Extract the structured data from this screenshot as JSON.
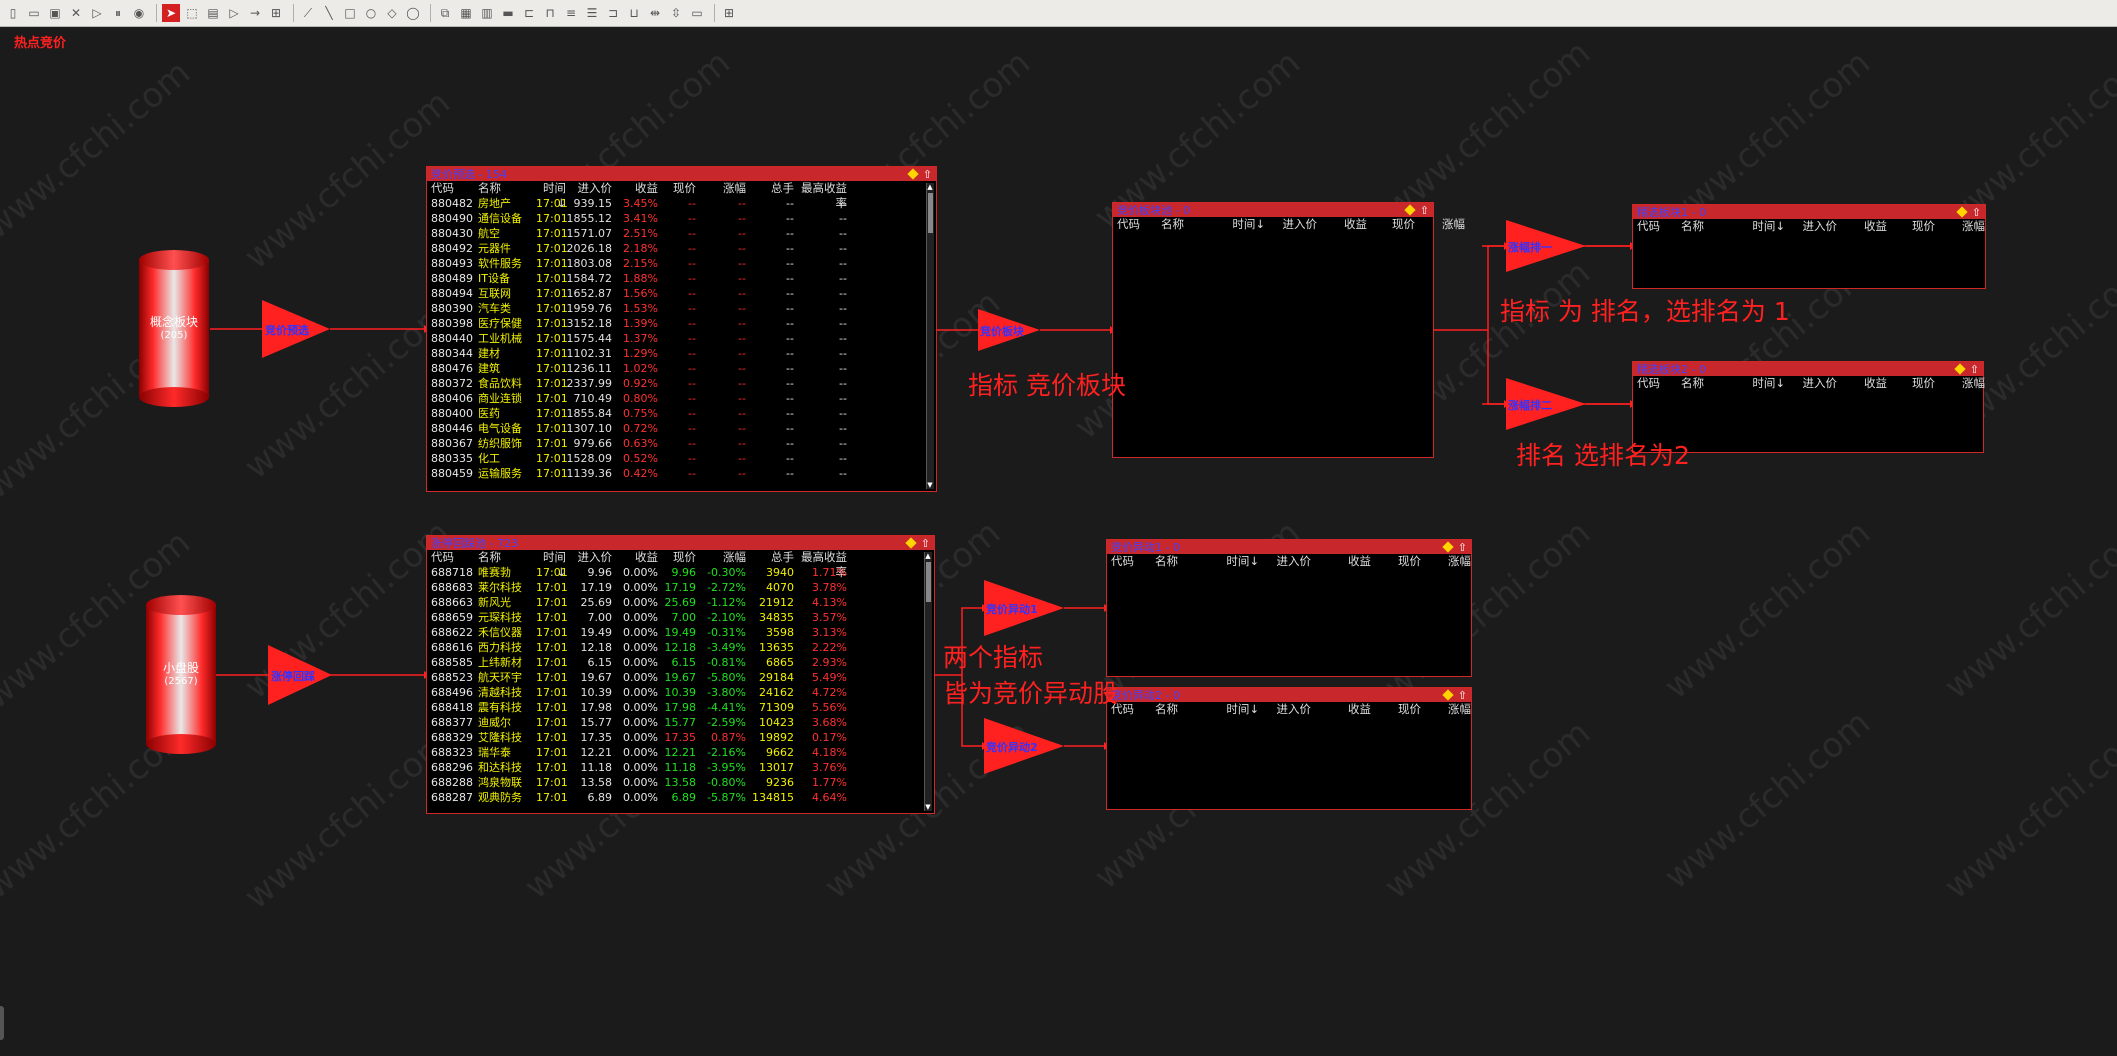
{
  "app": {
    "page_title": "热点竞价"
  },
  "watermark": "www.cfchi.com",
  "toolbar_icons": [
    "new-file-icon",
    "open-folder-icon",
    "save-icon",
    "close-icon",
    "play-icon",
    "pause-icon",
    "stop-icon",
    "|",
    "select-arrow-icon",
    "rect-select-icon",
    "table-icon",
    "triangle-icon",
    "arrow-icon",
    "group-icon",
    "|",
    "link-icon",
    "line-icon",
    "rectangle-icon",
    "circle-icon",
    "diamond-icon",
    "ellipse-icon",
    "|",
    "copy-icon",
    "paste-icon",
    "cut-icon",
    "erase-icon",
    "align-left-icon",
    "align-top-icon",
    "align-center-icon",
    "align-middle-icon",
    "align-right-icon",
    "align-bottom-icon",
    "distribute-h-icon",
    "distribute-v-icon",
    "same-size-icon",
    "|",
    "grid-icon"
  ],
  "sources": [
    {
      "label": "概念板块",
      "count": "(205)"
    },
    {
      "label": "小盘股",
      "count": "(2567)"
    }
  ],
  "triangles": {
    "t1": "竞价预选",
    "t2": "涨停回踩",
    "t3": "竞价板块",
    "t4": "涨幅排一",
    "t5": "涨幅排二",
    "t6": "竞价异动1",
    "t7": "竞价异动2"
  },
  "columns_full": [
    "代码",
    "名称",
    "时间↓",
    "进入价",
    "收益",
    "现价",
    "涨幅",
    "总手",
    "最高收益率"
  ],
  "columns_short": [
    "代码",
    "名称",
    "时间↓",
    "进入价",
    "收益",
    "现价",
    "涨幅"
  ],
  "panels": {
    "p1": {
      "title": "竞价预选 - 154",
      "rows": [
        [
          "880482",
          "房地产",
          "17:01",
          "939.15",
          "3.45%",
          "--",
          "--",
          "--",
          "--"
        ],
        [
          "880490",
          "通信设备",
          "17:01",
          "1855.12",
          "3.41%",
          "--",
          "--",
          "--",
          "--"
        ],
        [
          "880430",
          "航空",
          "17:01",
          "1571.07",
          "2.51%",
          "--",
          "--",
          "--",
          "--"
        ],
        [
          "880492",
          "元器件",
          "17:01",
          "2026.18",
          "2.18%",
          "--",
          "--",
          "--",
          "--"
        ],
        [
          "880493",
          "软件服务",
          "17:01",
          "1803.08",
          "2.15%",
          "--",
          "--",
          "--",
          "--"
        ],
        [
          "880489",
          "IT设备",
          "17:01",
          "1584.72",
          "1.88%",
          "--",
          "--",
          "--",
          "--"
        ],
        [
          "880494",
          "互联网",
          "17:01",
          "1652.87",
          "1.56%",
          "--",
          "--",
          "--",
          "--"
        ],
        [
          "880390",
          "汽车类",
          "17:01",
          "1959.76",
          "1.53%",
          "--",
          "--",
          "--",
          "--"
        ],
        [
          "880398",
          "医疗保健",
          "17:01",
          "3152.18",
          "1.39%",
          "--",
          "--",
          "--",
          "--"
        ],
        [
          "880440",
          "工业机械",
          "17:01",
          "1575.44",
          "1.37%",
          "--",
          "--",
          "--",
          "--"
        ],
        [
          "880344",
          "建材",
          "17:01",
          "1102.31",
          "1.29%",
          "--",
          "--",
          "--",
          "--"
        ],
        [
          "880476",
          "建筑",
          "17:01",
          "1236.11",
          "1.02%",
          "--",
          "--",
          "--",
          "--"
        ],
        [
          "880372",
          "食品饮料",
          "17:01",
          "2337.99",
          "0.92%",
          "--",
          "--",
          "--",
          "--"
        ],
        [
          "880406",
          "商业连锁",
          "17:01",
          "710.49",
          "0.80%",
          "--",
          "--",
          "--",
          "--"
        ],
        [
          "880400",
          "医药",
          "17:01",
          "1855.84",
          "0.75%",
          "--",
          "--",
          "--",
          "--"
        ],
        [
          "880446",
          "电气设备",
          "17:01",
          "1307.10",
          "0.72%",
          "--",
          "--",
          "--",
          "--"
        ],
        [
          "880367",
          "纺织服饰",
          "17:01",
          "979.66",
          "0.63%",
          "--",
          "--",
          "--",
          "--"
        ],
        [
          "880335",
          "化工",
          "17:01",
          "1528.09",
          "0.52%",
          "--",
          "--",
          "--",
          "--"
        ],
        [
          "880459",
          "运输服务",
          "17:01",
          "1139.36",
          "0.42%",
          "--",
          "--",
          "--",
          "--"
        ]
      ]
    },
    "p2": {
      "title": "涨停回踩池 - 723",
      "rows": [
        [
          "688718",
          "唯赛勃",
          "17:01",
          "9.96",
          "0.00%",
          "9.96",
          "-0.30%",
          "3940",
          "1.71%"
        ],
        [
          "688683",
          "莱尔科技",
          "17:01",
          "17.19",
          "0.00%",
          "17.19",
          "-2.72%",
          "4070",
          "3.78%"
        ],
        [
          "688663",
          "新风光",
          "17:01",
          "25.69",
          "0.00%",
          "25.69",
          "-1.12%",
          "21912",
          "4.13%"
        ],
        [
          "688659",
          "元琛科技",
          "17:01",
          "7.00",
          "0.00%",
          "7.00",
          "-2.10%",
          "34835",
          "3.57%"
        ],
        [
          "688622",
          "禾信仪器",
          "17:01",
          "19.49",
          "0.00%",
          "19.49",
          "-0.31%",
          "3598",
          "3.13%"
        ],
        [
          "688616",
          "西力科技",
          "17:01",
          "12.18",
          "0.00%",
          "12.18",
          "-3.49%",
          "13635",
          "2.22%"
        ],
        [
          "688585",
          "上纬新材",
          "17:01",
          "6.15",
          "0.00%",
          "6.15",
          "-0.81%",
          "6865",
          "2.93%"
        ],
        [
          "688523",
          "航天环宇",
          "17:01",
          "19.67",
          "0.00%",
          "19.67",
          "-5.80%",
          "29184",
          "5.49%"
        ],
        [
          "688496",
          "清越科技",
          "17:01",
          "10.39",
          "0.00%",
          "10.39",
          "-3.80%",
          "24162",
          "4.72%"
        ],
        [
          "688418",
          "震有科技",
          "17:01",
          "17.98",
          "0.00%",
          "17.98",
          "-4.41%",
          "71309",
          "5.56%"
        ],
        [
          "688377",
          "迪威尔",
          "17:01",
          "15.77",
          "0.00%",
          "15.77",
          "-2.59%",
          "10423",
          "3.68%"
        ],
        [
          "688329",
          "艾隆科技",
          "17:01",
          "17.35",
          "0.00%",
          "17.35",
          "0.87%",
          "19892",
          "0.17%"
        ],
        [
          "688323",
          "瑞华泰",
          "17:01",
          "12.21",
          "0.00%",
          "12.21",
          "-2.16%",
          "9662",
          "4.18%"
        ],
        [
          "688296",
          "和达科技",
          "17:01",
          "11.18",
          "0.00%",
          "11.18",
          "-3.95%",
          "13017",
          "3.76%"
        ],
        [
          "688288",
          "鸿泉物联",
          "17:01",
          "13.58",
          "0.00%",
          "13.58",
          "-0.80%",
          "9236",
          "1.77%"
        ],
        [
          "688287",
          "观典防务",
          "17:01",
          "6.89",
          "0.00%",
          "6.89",
          "-5.87%",
          "134815",
          "4.64%"
        ]
      ]
    },
    "p3": {
      "title": "竞价板块池 - 0"
    },
    "p4": {
      "title": "精选板块1 - 0"
    },
    "p5": {
      "title": "精选板块2 - 0"
    },
    "p6": {
      "title": "竞价异动1 - 0"
    },
    "p7": {
      "title": "竞价异动2 - 0"
    }
  },
  "notes": {
    "n1": "指标  竞价板块",
    "n2": "指标 为 排名，选排名为  1",
    "n3": "排名    选排名为2",
    "n4a": "两个指标",
    "n4b": "皆为竞价异动股"
  }
}
